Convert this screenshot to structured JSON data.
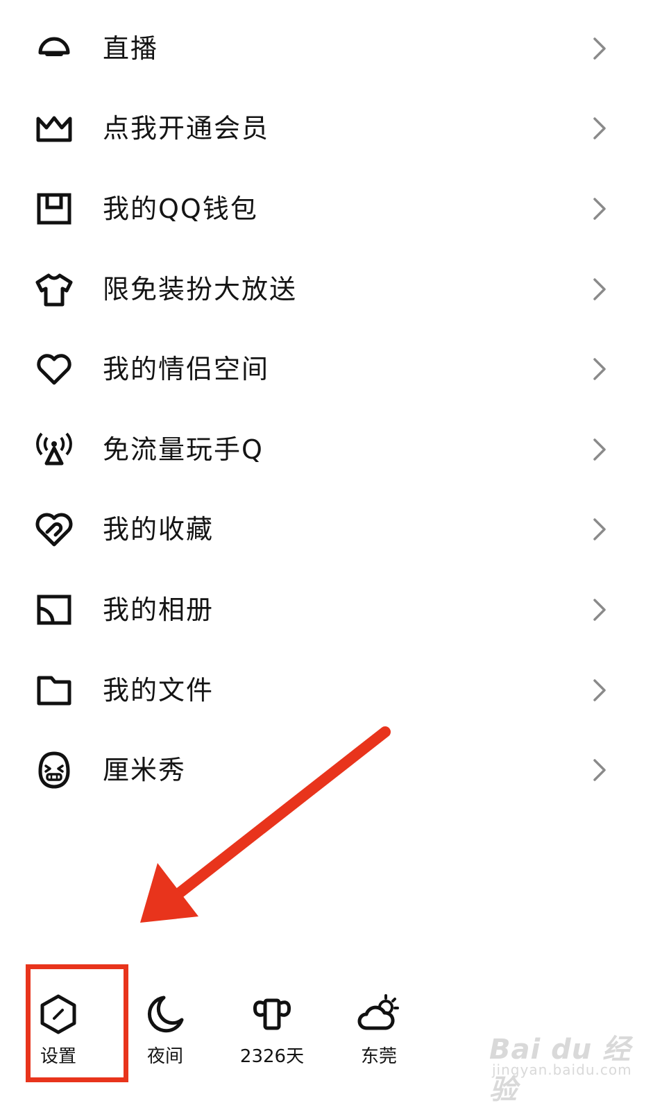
{
  "menu": {
    "items": [
      {
        "icon": "live-icon",
        "label": "直播"
      },
      {
        "icon": "crown-icon",
        "label": "点我开通会员"
      },
      {
        "icon": "wallet-icon",
        "label": "我的QQ钱包"
      },
      {
        "icon": "tshirt-icon",
        "label": "限免装扮大放送"
      },
      {
        "icon": "heart-icon",
        "label": "我的情侣空间"
      },
      {
        "icon": "signal-tower-icon",
        "label": "免流量玩手Q"
      },
      {
        "icon": "favorite-icon",
        "label": "我的收藏"
      },
      {
        "icon": "album-icon",
        "label": "我的相册"
      },
      {
        "icon": "folder-icon",
        "label": "我的文件"
      },
      {
        "icon": "cmshow-face-icon",
        "label": "厘米秀"
      }
    ]
  },
  "bottom_bar": {
    "settings": {
      "icon": "settings-hexagon-icon",
      "label": "设置"
    },
    "night": {
      "icon": "moon-icon",
      "label": "夜间"
    },
    "days": {
      "icon": "trophy-icon",
      "label": "2326天"
    },
    "weather": {
      "icon": "cloud-sun-icon",
      "label": "东莞"
    }
  },
  "annotation": {
    "color": "#e8341c"
  },
  "watermark": {
    "main": "Bai du 经验",
    "sub": "jingyan.baidu.com"
  }
}
